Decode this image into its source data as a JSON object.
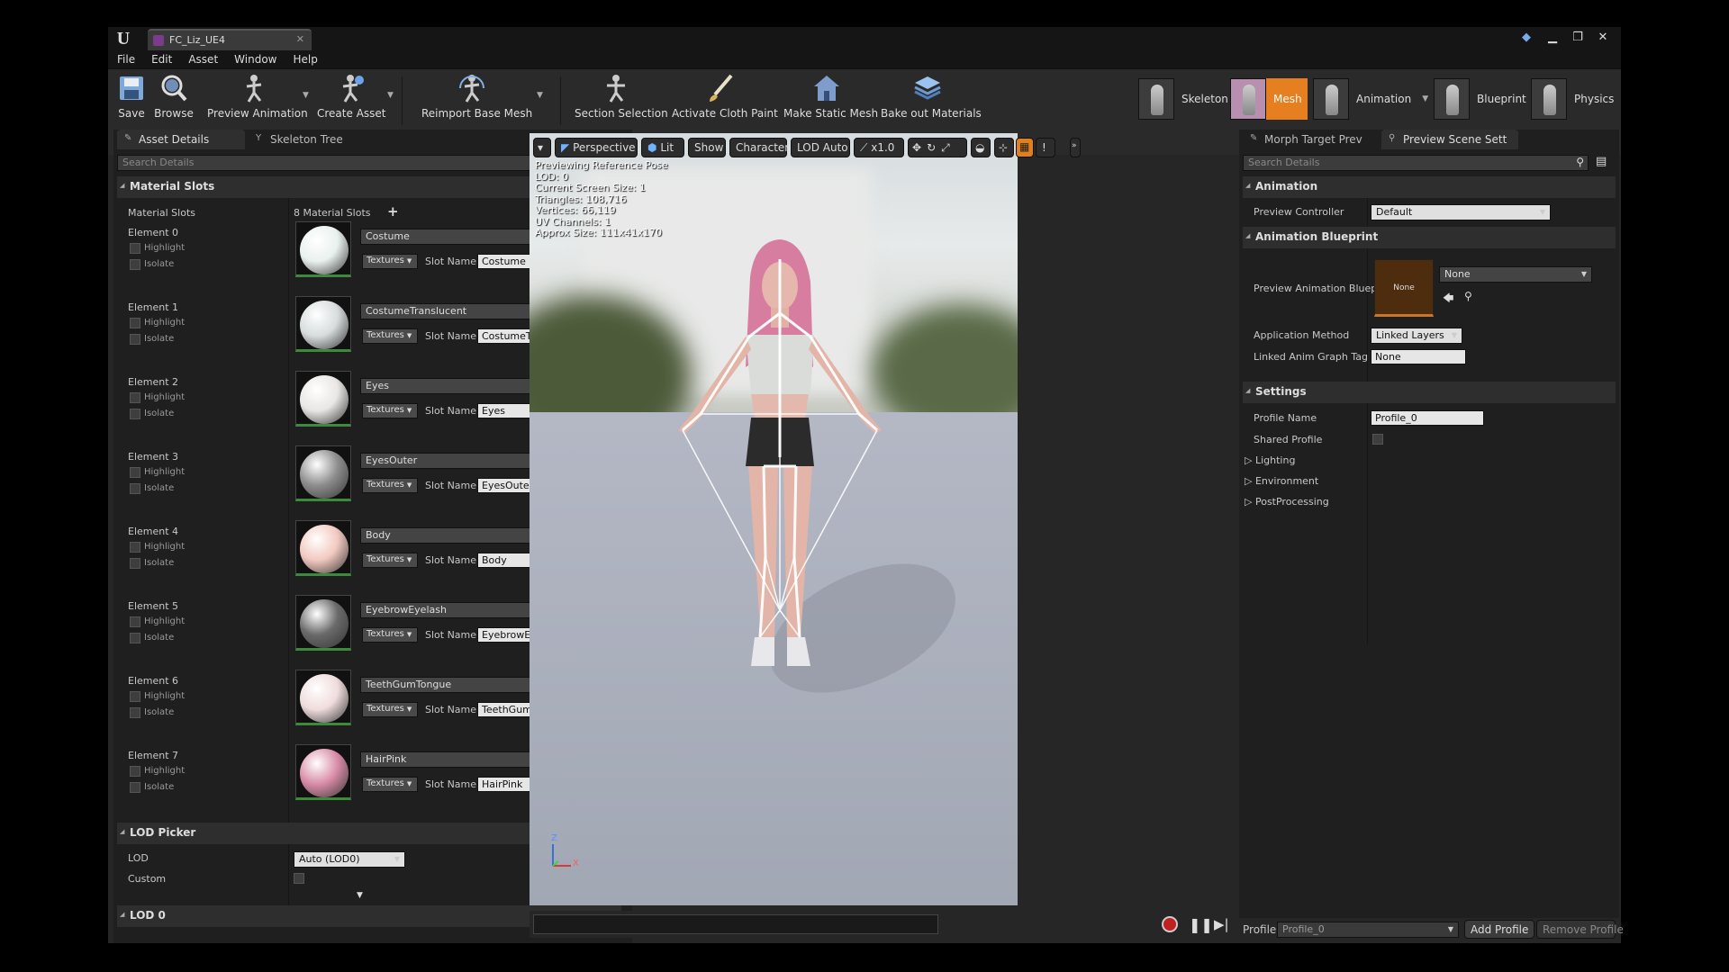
{
  "window": {
    "tab_title": "FC_Liz_UE4",
    "menu": [
      "File",
      "Edit",
      "Asset",
      "Window",
      "Help"
    ]
  },
  "toolbar": {
    "buttons": [
      {
        "label": "Save",
        "icon": "save-icon"
      },
      {
        "label": "Browse",
        "icon": "browse-icon"
      },
      {
        "label": "Preview Animation",
        "icon": "preview-animation-icon"
      },
      {
        "label": "Create Asset",
        "icon": "create-asset-icon"
      },
      {
        "label": "Reimport Base Mesh",
        "icon": "reimport-icon"
      },
      {
        "label": "Section Selection",
        "icon": "section-selection-icon"
      },
      {
        "label": "Activate Cloth Paint",
        "icon": "cloth-paint-icon"
      },
      {
        "label": "Make Static Mesh",
        "icon": "static-mesh-icon"
      },
      {
        "label": "Bake out Materials",
        "icon": "bake-materials-icon"
      }
    ],
    "modes": [
      {
        "label": "Skeleton",
        "active": false
      },
      {
        "label": "Mesh",
        "active": true
      },
      {
        "label": "Animation",
        "active": false
      },
      {
        "label": "Blueprint",
        "active": false
      },
      {
        "label": "Physics",
        "active": false
      }
    ]
  },
  "left_panel": {
    "tabs": [
      "Asset Details",
      "Skeleton Tree"
    ],
    "search_placeholder": "Search Details",
    "material_slots": {
      "category": "Material Slots",
      "row_label": "Material Slots",
      "count_text": "8 Material Slots",
      "highlight_label": "Highlight",
      "isolate_label": "Isolate",
      "textures_label": "Textures",
      "slot_name_label": "Slot Name",
      "elements": [
        {
          "label": "Element 0",
          "material": "Costume",
          "slot_name": "Costume",
          "color": "#e9f1ee"
        },
        {
          "label": "Element 1",
          "material": "CostumeTranslucent",
          "slot_name": "CostumeTranslucent",
          "color": "#d7dcdc"
        },
        {
          "label": "Element 2",
          "material": "Eyes",
          "slot_name": "Eyes",
          "color": "#e9e6e4"
        },
        {
          "label": "Element 3",
          "material": "EyesOuter",
          "slot_name": "EyesOuter",
          "color": "#8e8e8e"
        },
        {
          "label": "Element 4",
          "material": "Body",
          "slot_name": "Body",
          "color": "#f2c9c0"
        },
        {
          "label": "Element 5",
          "material": "EyebrowEyelash",
          "slot_name": "EyebrowEyelash",
          "color": "#6a6a6a"
        },
        {
          "label": "Element 6",
          "material": "TeethGumTongue",
          "slot_name": "TeethGumTongue",
          "color": "#f0dcdc"
        },
        {
          "label": "Element 7",
          "material": "HairPink",
          "slot_name": "HairPink",
          "color": "#d98ca7"
        }
      ]
    },
    "lod_picker": {
      "category": "LOD Picker",
      "lod_label": "LOD",
      "lod_value": "Auto (LOD0)",
      "custom_label": "Custom"
    },
    "lod0_category": "LOD 0"
  },
  "viewport": {
    "toolbar": {
      "perspective": "Perspective",
      "lit": "Lit",
      "show": "Show",
      "character": "Character",
      "lod": "LOD Auto",
      "speed": "x1.0",
      "warn": "!"
    },
    "stats": [
      "Previewing Reference Pose",
      "LOD: 0",
      "Current Screen Size: 1",
      "Triangles: 108,716",
      "Vertices: 66,119",
      "UV Channels: 1",
      "Approx Size: 111x41x170"
    ],
    "axis": {
      "z": "Z",
      "x": "X"
    }
  },
  "right_panel": {
    "tabs": [
      "Morph Target Prev",
      "Preview Scene Sett"
    ],
    "search_placeholder": "Search Details",
    "animation": {
      "category": "Animation",
      "preview_controller_label": "Preview Controller",
      "preview_controller_value": "Default"
    },
    "animation_blueprint": {
      "category": "Animation Blueprint",
      "preview_label": "Preview Animation Bluep",
      "thumb_text": "None",
      "combo_value": "None",
      "app_method_label": "Application Method",
      "app_method_value": "Linked Layers",
      "linked_tag_label": "Linked Anim Graph Tag",
      "linked_tag_value": "None"
    },
    "settings": {
      "category": "Settings",
      "profile_name_label": "Profile Name",
      "profile_name_value": "Profile_0",
      "shared_profile_label": "Shared Profile",
      "sub_categories": [
        "Lighting",
        "Environment",
        "PostProcessing"
      ]
    },
    "bottom": {
      "profile_label": "Profile",
      "profile_value": "Profile_0",
      "add_profile": "Add Profile",
      "remove_profile": "Remove Profile"
    }
  }
}
